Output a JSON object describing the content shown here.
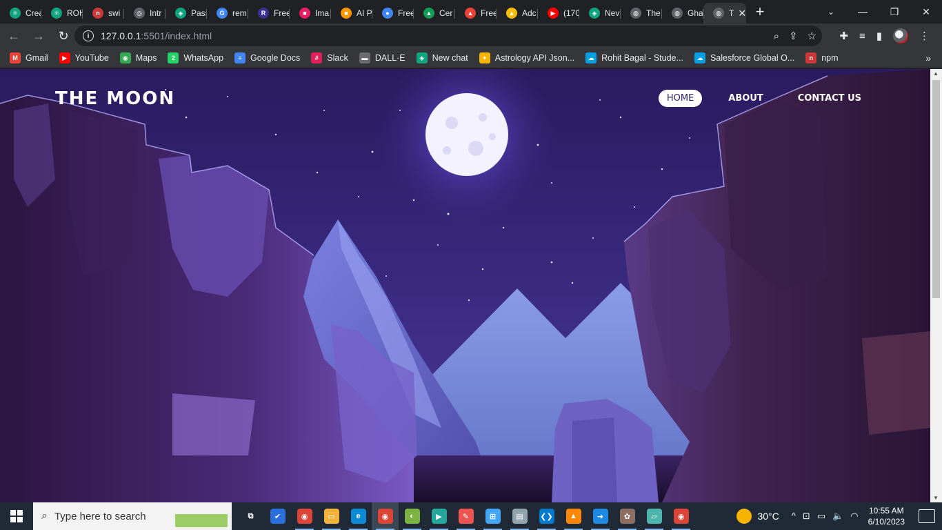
{
  "browser": {
    "tabs": [
      {
        "label": "Crea",
        "color": "#10a37f",
        "glyph": "⚛"
      },
      {
        "label": "ROH",
        "color": "#10a37f",
        "glyph": "⚛"
      },
      {
        "label": "swi",
        "color": "#cb3837",
        "glyph": "n"
      },
      {
        "label": "Intr",
        "color": "#5f6368",
        "glyph": "◎"
      },
      {
        "label": "Pass",
        "color": "#10a37f",
        "glyph": "◈"
      },
      {
        "label": "rem",
        "color": "#4285f4",
        "glyph": "G"
      },
      {
        "label": "Free",
        "color": "#3b2f8f",
        "glyph": "R"
      },
      {
        "label": "Ima",
        "color": "#e91e63",
        "glyph": "■"
      },
      {
        "label": "AI P",
        "color": "#ff9800",
        "glyph": "■"
      },
      {
        "label": "Free",
        "color": "#4285f4",
        "glyph": "●"
      },
      {
        "label": "Cer",
        "color": "#0f9d58",
        "glyph": "▲"
      },
      {
        "label": "Free",
        "color": "#ea4335",
        "glyph": "▲"
      },
      {
        "label": "Adc",
        "color": "#fbbc04",
        "glyph": "▲"
      },
      {
        "label": "(170",
        "color": "#ff0000",
        "glyph": "▶"
      },
      {
        "label": "Nev",
        "color": "#10a37f",
        "glyph": "◈"
      },
      {
        "label": "The",
        "color": "#5f6368",
        "glyph": "◍"
      },
      {
        "label": "Gha",
        "color": "#5f6368",
        "glyph": "◍"
      },
      {
        "label": "T",
        "color": "#5f6368",
        "glyph": "◍"
      }
    ],
    "close_glyph": "✕",
    "new_tab_glyph": "+",
    "tab_search_glyph": "⌄",
    "window_controls": {
      "minimize": "—",
      "restore": "❐",
      "close": "✕"
    },
    "toolbar": {
      "back": "←",
      "forward": "→",
      "reload": "↻",
      "url_host": "127.0.0.1",
      "url_rest": ":5501/index.html",
      "info_glyph": "i",
      "zoom_glyph": "⌕",
      "share_glyph": "⇪",
      "star_glyph": "☆",
      "extensions_glyph": "✚",
      "media_glyph": "≡",
      "sidepanel_glyph": "▮",
      "menu_glyph": "⋮"
    },
    "bookmarks": [
      {
        "label": "Gmail",
        "color": "#ea4335",
        "glyph": "M"
      },
      {
        "label": "YouTube",
        "color": "#ff0000",
        "glyph": "▶"
      },
      {
        "label": "Maps",
        "color": "#34a853",
        "glyph": "◉"
      },
      {
        "label": "WhatsApp",
        "color": "#25d366",
        "glyph": "2"
      },
      {
        "label": "Google Docs",
        "color": "#4285f4",
        "glyph": "≡"
      },
      {
        "label": "Slack",
        "color": "#e01e5a",
        "glyph": "#"
      },
      {
        "label": "DALL·E",
        "color": "#6b6b6b",
        "glyph": "▬"
      },
      {
        "label": "New chat",
        "color": "#10a37f",
        "glyph": "◈"
      },
      {
        "label": "Astrology API Json...",
        "color": "#f4b400",
        "glyph": "✦"
      },
      {
        "label": "Rohit Bagal - Stude...",
        "color": "#00a1e0",
        "glyph": "☁"
      },
      {
        "label": "Salesforce Global O...",
        "color": "#00a1e0",
        "glyph": "☁"
      },
      {
        "label": "npm",
        "color": "#cb3837",
        "glyph": "n"
      }
    ],
    "bookmarks_more": "»"
  },
  "site": {
    "logo": "THE MOON",
    "nav": [
      {
        "label": "HOME",
        "active": true
      },
      {
        "label": "ABOUT",
        "active": false
      },
      {
        "label": "CONTACT US",
        "active": false
      }
    ]
  },
  "taskbar": {
    "search_placeholder": "Type here to search",
    "search_glyph": "⌕",
    "apps": [
      {
        "name": "task-view",
        "glyph": "⧉",
        "color": "#1f2a36"
      },
      {
        "name": "todo",
        "glyph": "✔",
        "color": "#2b6fdc"
      },
      {
        "name": "chrome",
        "glyph": "◉",
        "color": "#db4437"
      },
      {
        "name": "file-explorer",
        "glyph": "▭",
        "color": "#f2b33d"
      },
      {
        "name": "edge",
        "glyph": "e",
        "color": "#0c8ad6"
      },
      {
        "name": "chrome-active",
        "glyph": "◉",
        "color": "#db4437"
      },
      {
        "name": "app-green",
        "glyph": "◐",
        "color": "#7cb342"
      },
      {
        "name": "app-media",
        "glyph": "▶",
        "color": "#26a69a"
      },
      {
        "name": "app-paint",
        "glyph": "✎",
        "color": "#ef5350"
      },
      {
        "name": "app-control",
        "glyph": "⊞",
        "color": "#42a5f5"
      },
      {
        "name": "app-drive",
        "glyph": "▤",
        "color": "#90a4ae"
      },
      {
        "name": "vscode",
        "glyph": "❮❯",
        "color": "#007acc"
      },
      {
        "name": "vlc",
        "glyph": "▲",
        "color": "#ff8800"
      },
      {
        "name": "app-arrow",
        "glyph": "➜",
        "color": "#1e88e5"
      },
      {
        "name": "app-palette",
        "glyph": "✿",
        "color": "#8d6e63"
      },
      {
        "name": "app-notes",
        "glyph": "▱",
        "color": "#4db6ac"
      },
      {
        "name": "chrome-2",
        "glyph": "◉",
        "color": "#db4437"
      }
    ],
    "weather": "30°C",
    "tray_icons": [
      "^",
      "⊡",
      "▭",
      "🔈",
      "◠"
    ],
    "time": "10:55 AM",
    "date": "6/10/2023"
  }
}
